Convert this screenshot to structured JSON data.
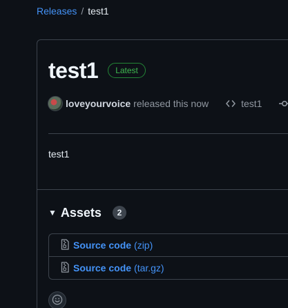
{
  "breadcrumb": {
    "parent": "Releases",
    "separator": "/",
    "current": "test1"
  },
  "release": {
    "title": "test1",
    "badge": "Latest",
    "author": "loveyourvoice",
    "released_text": "released this now",
    "tag": "test1",
    "body": "test1"
  },
  "assets": {
    "title": "Assets",
    "count": "2",
    "items": [
      {
        "name": "Source code",
        "ext": "(zip)"
      },
      {
        "name": "Source code",
        "ext": "(tar.gz)"
      }
    ]
  },
  "colors": {
    "background": "#0d1117",
    "link": "#4493f8",
    "latest_green": "#3fb950",
    "border": "#3d444d"
  },
  "icons": {
    "tag": "code-icon",
    "commit": "git-commit-icon",
    "asset": "file-zip-icon",
    "reaction": "smiley-icon"
  }
}
